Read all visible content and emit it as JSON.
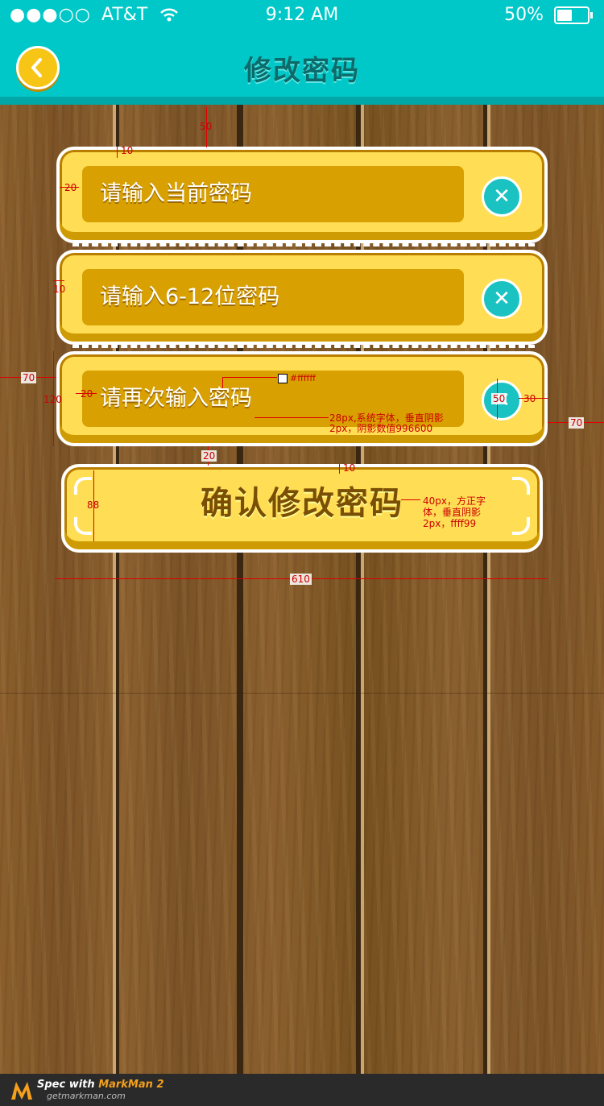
{
  "status_bar": {
    "signal": "●●●○○",
    "carrier": "AT&T",
    "time": "9:12 AM",
    "battery": "50%"
  },
  "header": {
    "back_icon": "chevron-left-icon",
    "title": "修改密码"
  },
  "fields": [
    {
      "placeholder": "请输入当前密码",
      "clear_icon": "close-icon",
      "clear_label": "✕"
    },
    {
      "placeholder": "请输入6-12位密码",
      "clear_icon": "close-icon",
      "clear_label": "✕"
    },
    {
      "placeholder": "请再次输入密码",
      "clear_icon": "close-icon",
      "clear_label": "✕"
    }
  ],
  "confirm_button": {
    "label": "确认修改密码"
  },
  "annotations": {
    "top_margin": "50",
    "card_inset_top": "10",
    "field_inset_left": "20",
    "card_gap": "10",
    "left_margin": "70",
    "card_height": "120",
    "field_pad": "20",
    "swatch_color": "#ffffff",
    "font_note_1": "28px,系统字体，垂直阴影",
    "font_note_2": "2px，阴影数值996600",
    "button_size": "50",
    "button_right": "30",
    "right_margin": "70",
    "confirm_gap": "20",
    "confirm_inset": "10",
    "confirm_height": "88",
    "confirm_note_1": "40px，方正字",
    "confirm_note_2": "体，垂直阴影",
    "confirm_note_3": "2px，ffff99",
    "total_width": "610"
  },
  "colors": {
    "header_bg": "#00c8c8",
    "card_yellow": "#ffde55",
    "field_gold": "#d8a000",
    "text_shadow_field": "#996600",
    "text_shadow_button": "#ffff99",
    "clear_button": "#1bc2c2"
  },
  "footer": {
    "spec_with": "Spec with ",
    "brand": "MarkMan 2",
    "url": "getmarkman.com"
  }
}
